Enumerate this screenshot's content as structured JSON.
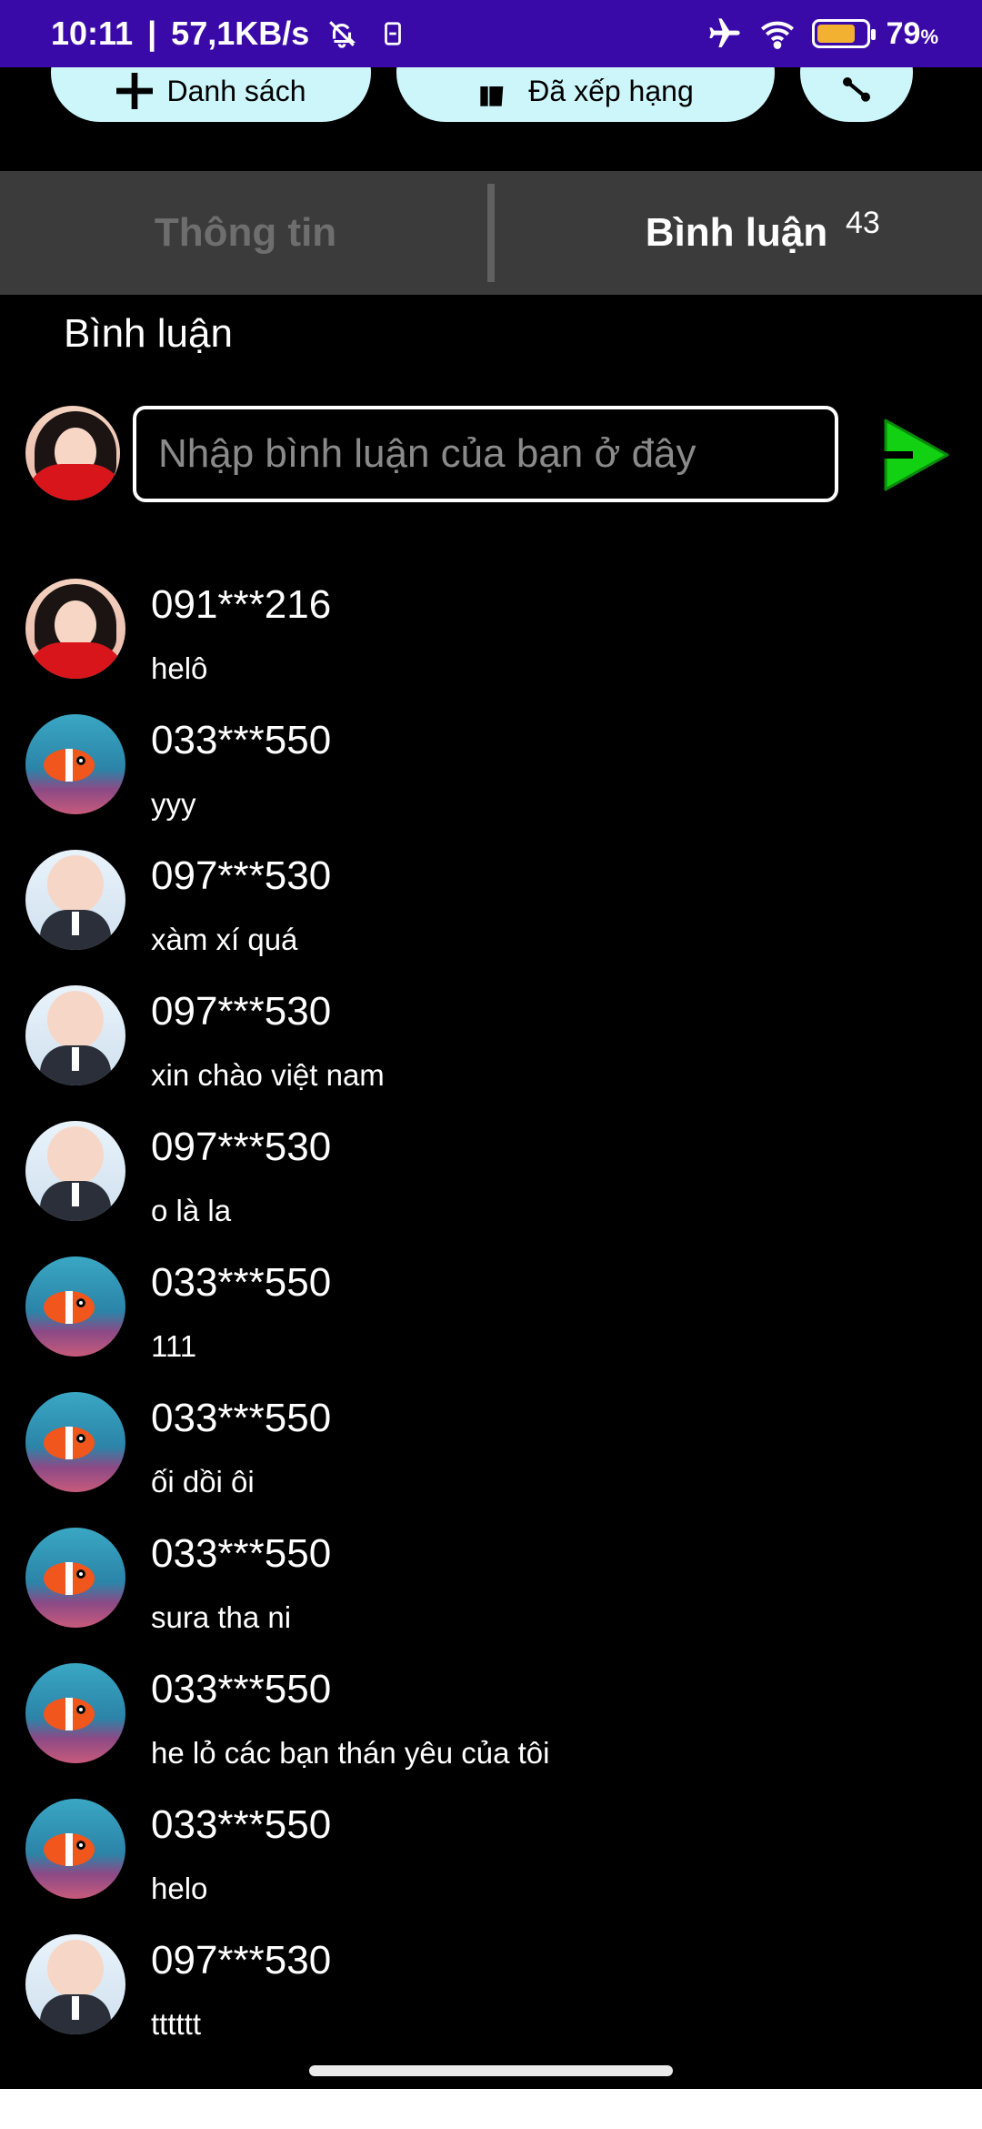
{
  "status_bar": {
    "time": "10:11",
    "separator": "|",
    "speed": "57,1KB/s",
    "battery_percent": "79",
    "battery_unit": "%",
    "battery_level": 0.79,
    "accent_color": "#3a0aa8"
  },
  "top_actions": {
    "list_label": "Danh sách",
    "rank_label": "Đã xếp hạng"
  },
  "tabs": {
    "info_label": "Thông tin",
    "comments_label": "Bình luận",
    "comments_count": "43"
  },
  "section_title": "Bình luận",
  "input": {
    "placeholder": "Nhập bình luận của bạn ở đây"
  },
  "comments": [
    {
      "user": "091***216",
      "text": "helô",
      "avatar": "girl-avatar"
    },
    {
      "user": "033***550",
      "text": "yyy",
      "avatar": "fish-avatar"
    },
    {
      "user": "097***530",
      "text": "xàm xí quá",
      "avatar": "baby-avatar"
    },
    {
      "user": "097***530",
      "text": "xin chào việt nam",
      "avatar": "baby-avatar"
    },
    {
      "user": "097***530",
      "text": "o là la",
      "avatar": "baby-avatar"
    },
    {
      "user": "033***550",
      "text": "111",
      "avatar": "fish-avatar"
    },
    {
      "user": "033***550",
      "text": "ối dồi ôi",
      "avatar": "fish-avatar"
    },
    {
      "user": "033***550",
      "text": "sura tha ni",
      "avatar": "fish-avatar"
    },
    {
      "user": "033***550",
      "text": "he lỏ các bạn thán yêu của tôi",
      "avatar": "fish-avatar"
    },
    {
      "user": "033***550",
      "text": "helo",
      "avatar": "fish-avatar"
    },
    {
      "user": "097***530",
      "text": "tttttt",
      "avatar": "baby-avatar"
    }
  ],
  "colors": {
    "send_green": "#12d112",
    "tab_bar": "#3b3b3b",
    "pill_bg": "#cdf6fb"
  }
}
